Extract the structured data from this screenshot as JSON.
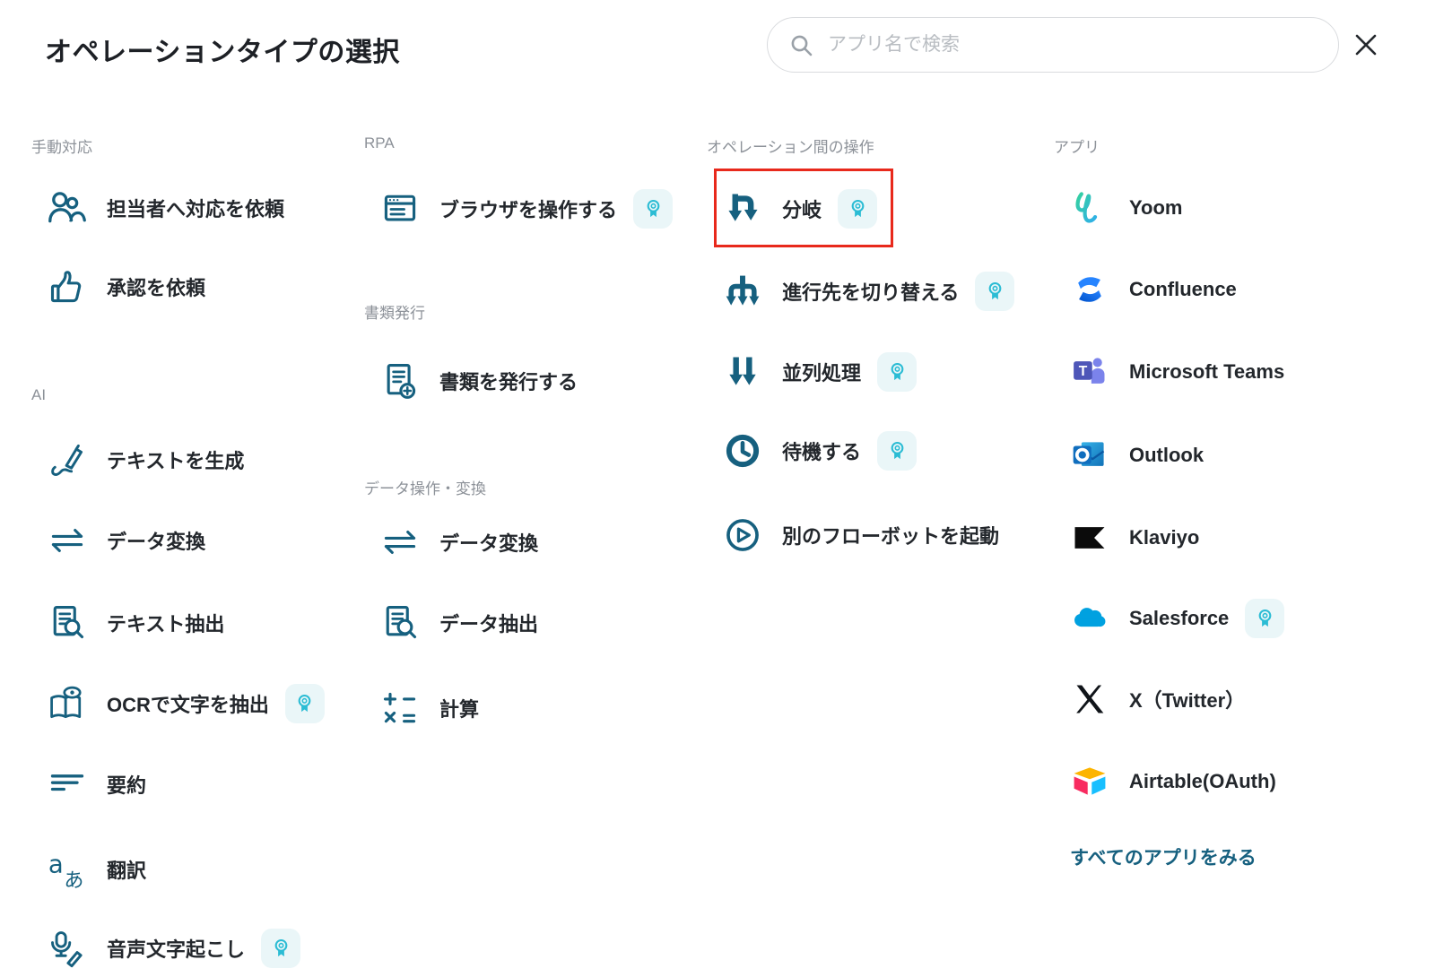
{
  "header": {
    "title": "オペレーションタイプの選択",
    "search_placeholder": "アプリ名で検索"
  },
  "sections": {
    "manual": {
      "label": "手動対応"
    },
    "ai": {
      "label": "AI"
    },
    "rpa": {
      "label": "RPA"
    },
    "docs": {
      "label": "書類発行"
    },
    "dataops": {
      "label": "データ操作・変換"
    },
    "interop": {
      "label": "オペレーション間の操作"
    },
    "apps": {
      "label": "アプリ"
    }
  },
  "items": {
    "assign": {
      "label": "担当者へ対応を依頼"
    },
    "approval": {
      "label": "承認を依頼"
    },
    "gen_text": {
      "label": "テキストを生成"
    },
    "convert_ai": {
      "label": "データ変換"
    },
    "extract_text": {
      "label": "テキスト抽出"
    },
    "ocr": {
      "label": "OCRで文字を抽出"
    },
    "summary": {
      "label": "要約"
    },
    "translate": {
      "label": "翻訳"
    },
    "speech": {
      "label": "音声文字起こし"
    },
    "browser": {
      "label": "ブラウザを操作する"
    },
    "issue_doc": {
      "label": "書類を発行する"
    },
    "convert_data": {
      "label": "データ変換"
    },
    "extract_data": {
      "label": "データ抽出"
    },
    "calc": {
      "label": "計算"
    },
    "branch": {
      "label": "分岐"
    },
    "switch": {
      "label": "進行先を切り替える"
    },
    "parallel": {
      "label": "並列処理"
    },
    "wait": {
      "label": "待機する"
    },
    "launch": {
      "label": "別のフローボットを起動"
    },
    "yoom": {
      "label": "Yoom"
    },
    "confluence": {
      "label": "Confluence"
    },
    "teams": {
      "label": "Microsoft Teams"
    },
    "outlook": {
      "label": "Outlook"
    },
    "klaviyo": {
      "label": "Klaviyo"
    },
    "salesforce": {
      "label": "Salesforce"
    },
    "x_twitter": {
      "label": "X（Twitter）"
    },
    "airtable": {
      "label": "Airtable(OAuth)"
    }
  },
  "footer": {
    "view_all_apps": "すべてのアプリをみる"
  },
  "colors": {
    "icon_teal": "#16607f",
    "badge_cyan": "#2bbcd4",
    "badge_background": "#eaf6f8",
    "highlight_red": "#e8291c",
    "link_teal": "#16607f",
    "section_gray": "#8d9299"
  }
}
